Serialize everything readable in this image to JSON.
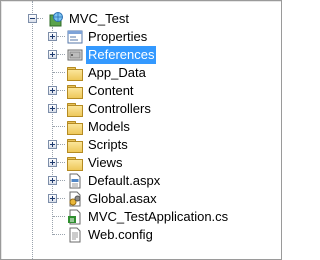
{
  "project": {
    "name": "MVC_Test"
  },
  "items": [
    {
      "label": "Properties",
      "icon": "properties-icon",
      "expander": "plus"
    },
    {
      "label": "References",
      "icon": "references-icon",
      "expander": "plus",
      "selected": true
    },
    {
      "label": "App_Data",
      "icon": "folder-icon"
    },
    {
      "label": "Content",
      "icon": "folder-icon",
      "expander": "plus"
    },
    {
      "label": "Controllers",
      "icon": "folder-icon",
      "expander": "plus"
    },
    {
      "label": "Models",
      "icon": "folder-icon"
    },
    {
      "label": "Scripts",
      "icon": "folder-icon",
      "expander": "plus"
    },
    {
      "label": "Views",
      "icon": "folder-icon",
      "expander": "plus"
    },
    {
      "label": "Default.aspx",
      "icon": "aspx-file-icon",
      "expander": "plus"
    },
    {
      "label": "Global.asax",
      "icon": "asax-file-icon",
      "expander": "plus"
    },
    {
      "label": "MVC_TestApplication.cs",
      "icon": "csharp-file-icon"
    },
    {
      "label": "Web.config",
      "icon": "config-file-icon"
    }
  ],
  "colors": {
    "selection": "#3399ff",
    "folder": "#eec85a"
  }
}
